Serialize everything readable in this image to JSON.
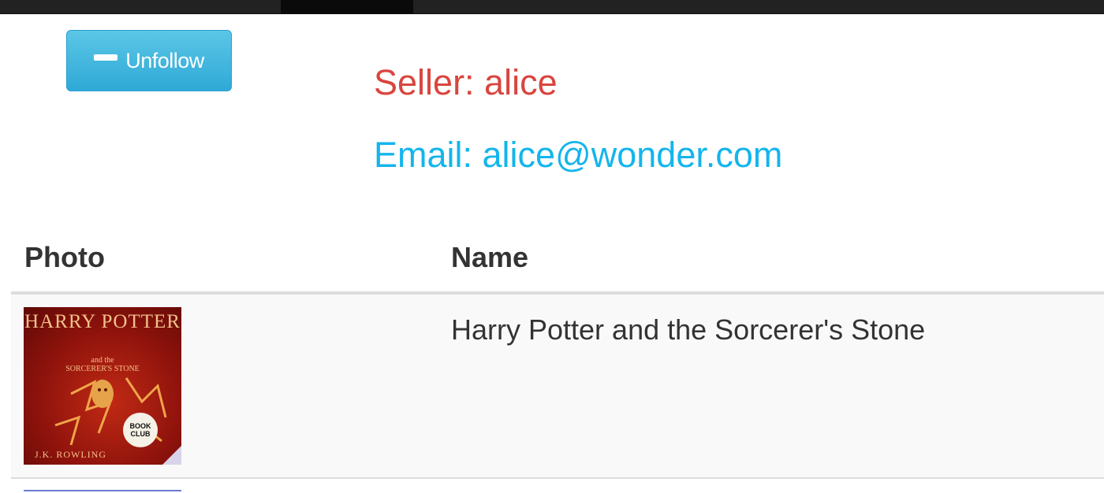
{
  "nav": {},
  "actions": {
    "unfollow_label": "Unfollow"
  },
  "seller": {
    "text": "Seller: alice"
  },
  "email": {
    "text": "Email: alice@wonder.com"
  },
  "table": {
    "headers": [
      "Photo",
      "Name"
    ],
    "rows": [
      {
        "cover": {
          "title": "HARRY POTTER",
          "subtitle_top": "and the",
          "subtitle": "SORCERER'S STONE",
          "author": "J.K. ROWLING",
          "badge": "BOOK CLUB"
        },
        "name": "Harry Potter and the Sorcerer's Stone"
      }
    ]
  },
  "colors": {
    "seller": "#d9453f",
    "email": "#14b5ec",
    "button": "#2fa9d7"
  }
}
